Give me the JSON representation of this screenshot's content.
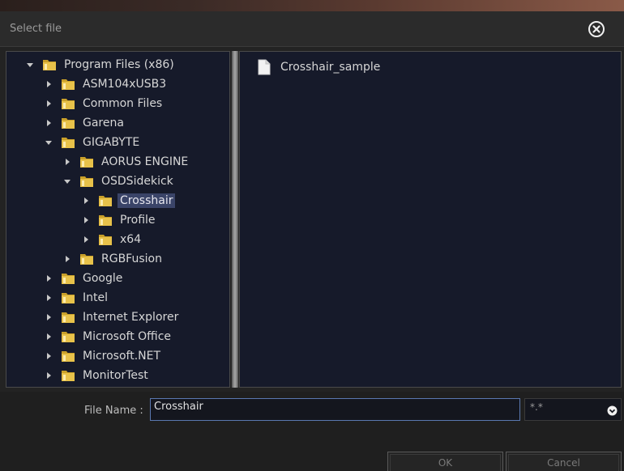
{
  "dialog": {
    "title": "Select file",
    "close_icon": "close-circle-icon"
  },
  "tree": {
    "items": [
      {
        "label": "Program Files (x86)",
        "level": 0,
        "expanded": true,
        "selected": false
      },
      {
        "label": "ASM104xUSB3",
        "level": 1,
        "expanded": false,
        "selected": false
      },
      {
        "label": "Common Files",
        "level": 1,
        "expanded": false,
        "selected": false
      },
      {
        "label": "Garena",
        "level": 1,
        "expanded": false,
        "selected": false
      },
      {
        "label": "GIGABYTE",
        "level": 1,
        "expanded": true,
        "selected": false
      },
      {
        "label": "AORUS ENGINE",
        "level": 2,
        "expanded": false,
        "selected": false
      },
      {
        "label": "OSDSidekick",
        "level": 2,
        "expanded": true,
        "selected": false
      },
      {
        "label": "Crosshair",
        "level": 3,
        "expanded": false,
        "selected": true
      },
      {
        "label": "Profile",
        "level": 3,
        "expanded": false,
        "selected": false
      },
      {
        "label": "x64",
        "level": 3,
        "expanded": false,
        "selected": false
      },
      {
        "label": "RGBFusion",
        "level": 2,
        "expanded": false,
        "selected": false
      },
      {
        "label": "Google",
        "level": 1,
        "expanded": false,
        "selected": false
      },
      {
        "label": "Intel",
        "level": 1,
        "expanded": false,
        "selected": false
      },
      {
        "label": "Internet Explorer",
        "level": 1,
        "expanded": false,
        "selected": false
      },
      {
        "label": "Microsoft Office",
        "level": 1,
        "expanded": false,
        "selected": false
      },
      {
        "label": "Microsoft.NET",
        "level": 1,
        "expanded": false,
        "selected": false
      },
      {
        "label": "MonitorTest",
        "level": 1,
        "expanded": false,
        "selected": false
      }
    ]
  },
  "files": {
    "items": [
      {
        "label": "Crosshair_sample",
        "icon": "file-icon"
      }
    ]
  },
  "footer": {
    "file_name_label": "File Name :",
    "file_name_value": "Crosshair",
    "filter_value": "*.*",
    "ok_label": "OK",
    "cancel_label": "Cancel"
  },
  "colors": {
    "panel_bg": "#161a2a",
    "selection_bg": "#3a4468",
    "folder": "#e8c24a",
    "input_border": "#5a78b0"
  }
}
